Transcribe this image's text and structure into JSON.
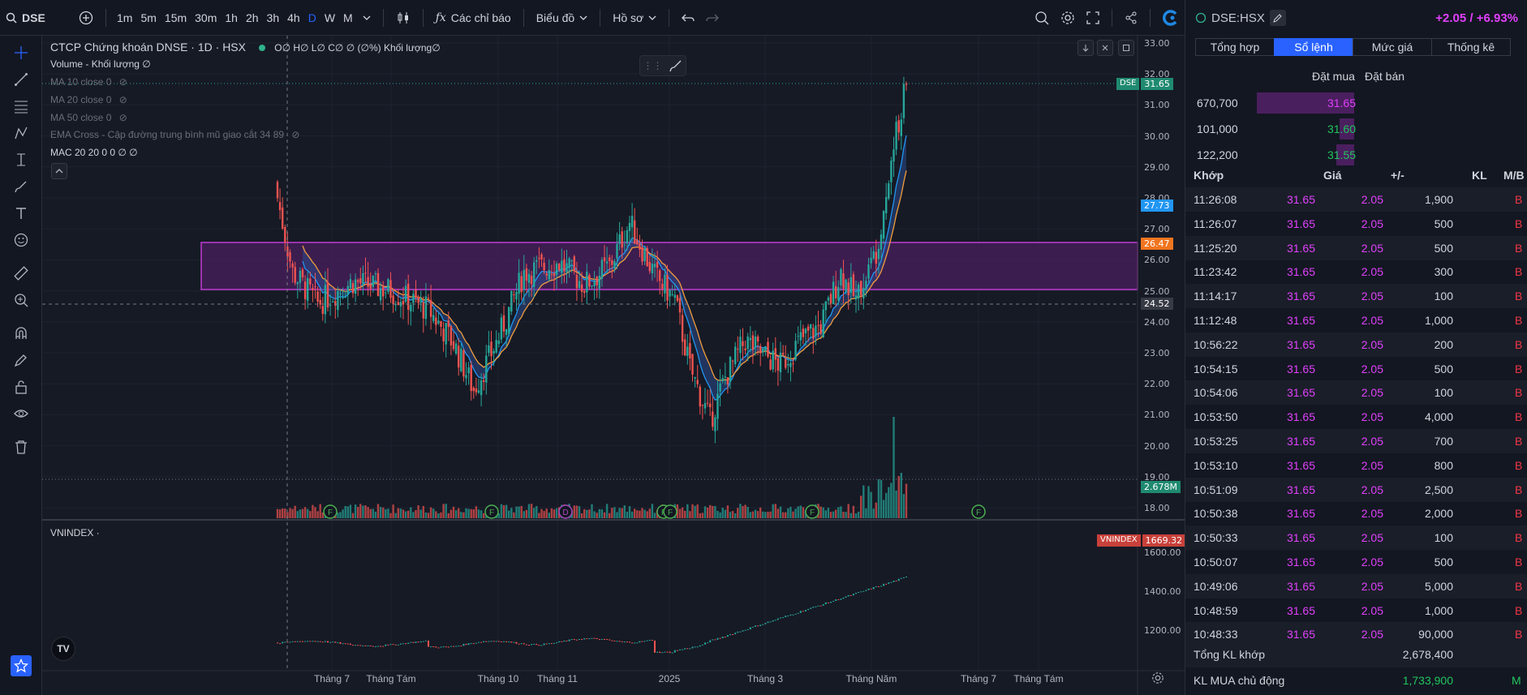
{
  "toolbar": {
    "symbol": "DSE",
    "intervals": [
      "1m",
      "5m",
      "15m",
      "30m",
      "1h",
      "2h",
      "3h",
      "4h",
      "D",
      "W",
      "M"
    ],
    "active_interval": "D",
    "indicators_label": "Các chỉ báo",
    "chart_label": "Biểu đồ",
    "profile_label": "Hồ sơ"
  },
  "chart": {
    "title": "CTCP Chứng khoán DNSE · 1D · HSX",
    "ohlc": "O∅ H∅ L∅ C∅ ∅ (∅%) Khối lượng∅",
    "volume_legend": "Volume - Khối lượng  ∅",
    "ma10": "MA 10 close 0",
    "ma20": "MA 20 close 0",
    "ma50": "MA 50 close 0",
    "ema_cross": "EMA Cross - Cập đường trung bình mũ giao cắt 34 89",
    "mac": "MAC 20 20 0 0  ∅ ∅",
    "index_legend": "VNINDEX ·",
    "price_axis": [
      "33.00",
      "32.00",
      "31.00",
      "30.00",
      "29.00",
      "28.00",
      "27.00",
      "26.00",
      "25.00",
      "24.00",
      "23.00",
      "22.00",
      "21.00",
      "20.00",
      "19.00",
      "18.00"
    ],
    "index_axis": [
      "1600.00",
      "1400.00",
      "1200.00"
    ],
    "time_axis": [
      "Tháng 7",
      "Tháng Tám",
      "Tháng 10",
      "Tháng 11",
      "2025",
      "Tháng 3",
      "Tháng Năm",
      "Tháng 7",
      "Tháng Tám"
    ],
    "tags": {
      "dse_name": "DSE",
      "dse_price": "31.65",
      "ema_blue": "27.73",
      "ema_orange": "26.47",
      "crosshair": "24.52",
      "volume": "2.678M",
      "vnindex_name": "VNINDEX",
      "vnindex_value": "1669.32"
    },
    "event_markers": [
      "F",
      "F",
      "D",
      "F",
      "F",
      "F",
      "F"
    ],
    "colors": {
      "up": "#26a69a",
      "down": "#ef5350",
      "zone_border": "#c03bd4",
      "zone_fill": "#4a1f5e",
      "ema_fast": "#2196f3",
      "ema_slow": "#f39c3b"
    }
  },
  "panel": {
    "symbol": "DSE:HSX",
    "change": "+2.05 / +6.93%",
    "tabs": [
      "Tổng hợp",
      "Sổ lệnh",
      "Mức giá",
      "Thống kê"
    ],
    "active_tab": "Sổ lệnh",
    "order_book": {
      "bid_header": "Đặt mua",
      "ask_header": "Đặt bán",
      "rows": [
        {
          "volume": "670,700",
          "price": "31.65",
          "color": "#e040fb",
          "fill": 1.0
        },
        {
          "volume": "101,000",
          "price": "31.60",
          "color": "#22c55e",
          "fill": 0.15
        },
        {
          "volume": "122,200",
          "price": "31.55",
          "color": "#22c55e",
          "fill": 0.18
        }
      ]
    },
    "trades": {
      "headers": [
        "Khớp",
        "Giá",
        "+/-",
        "KL",
        "M/B"
      ],
      "rows": [
        [
          "11:26:08",
          "31.65",
          "2.05",
          "1,900",
          "B"
        ],
        [
          "11:26:07",
          "31.65",
          "2.05",
          "500",
          "B"
        ],
        [
          "11:25:20",
          "31.65",
          "2.05",
          "500",
          "B"
        ],
        [
          "11:23:42",
          "31.65",
          "2.05",
          "300",
          "B"
        ],
        [
          "11:14:17",
          "31.65",
          "2.05",
          "100",
          "B"
        ],
        [
          "11:12:48",
          "31.65",
          "2.05",
          "1,000",
          "B"
        ],
        [
          "10:56:22",
          "31.65",
          "2.05",
          "200",
          "B"
        ],
        [
          "10:54:15",
          "31.65",
          "2.05",
          "500",
          "B"
        ],
        [
          "10:54:06",
          "31.65",
          "2.05",
          "100",
          "B"
        ],
        [
          "10:53:50",
          "31.65",
          "2.05",
          "4,000",
          "B"
        ],
        [
          "10:53:25",
          "31.65",
          "2.05",
          "700",
          "B"
        ],
        [
          "10:53:10",
          "31.65",
          "2.05",
          "800",
          "B"
        ],
        [
          "10:51:09",
          "31.65",
          "2.05",
          "2,500",
          "B"
        ],
        [
          "10:50:38",
          "31.65",
          "2.05",
          "2,000",
          "B"
        ],
        [
          "10:50:33",
          "31.65",
          "2.05",
          "100",
          "B"
        ],
        [
          "10:50:07",
          "31.65",
          "2.05",
          "500",
          "B"
        ],
        [
          "10:49:06",
          "31.65",
          "2.05",
          "5,000",
          "B"
        ],
        [
          "10:48:59",
          "31.65",
          "2.05",
          "1,000",
          "B"
        ],
        [
          "10:48:33",
          "31.65",
          "2.05",
          "90,000",
          "B"
        ]
      ]
    },
    "total_label": "Tổng KL khớp",
    "total_value": "2,678,400",
    "buy_active_label": "KL MUA chủ động",
    "buy_active_value": "1,733,900",
    "buy_active_side": "M"
  }
}
